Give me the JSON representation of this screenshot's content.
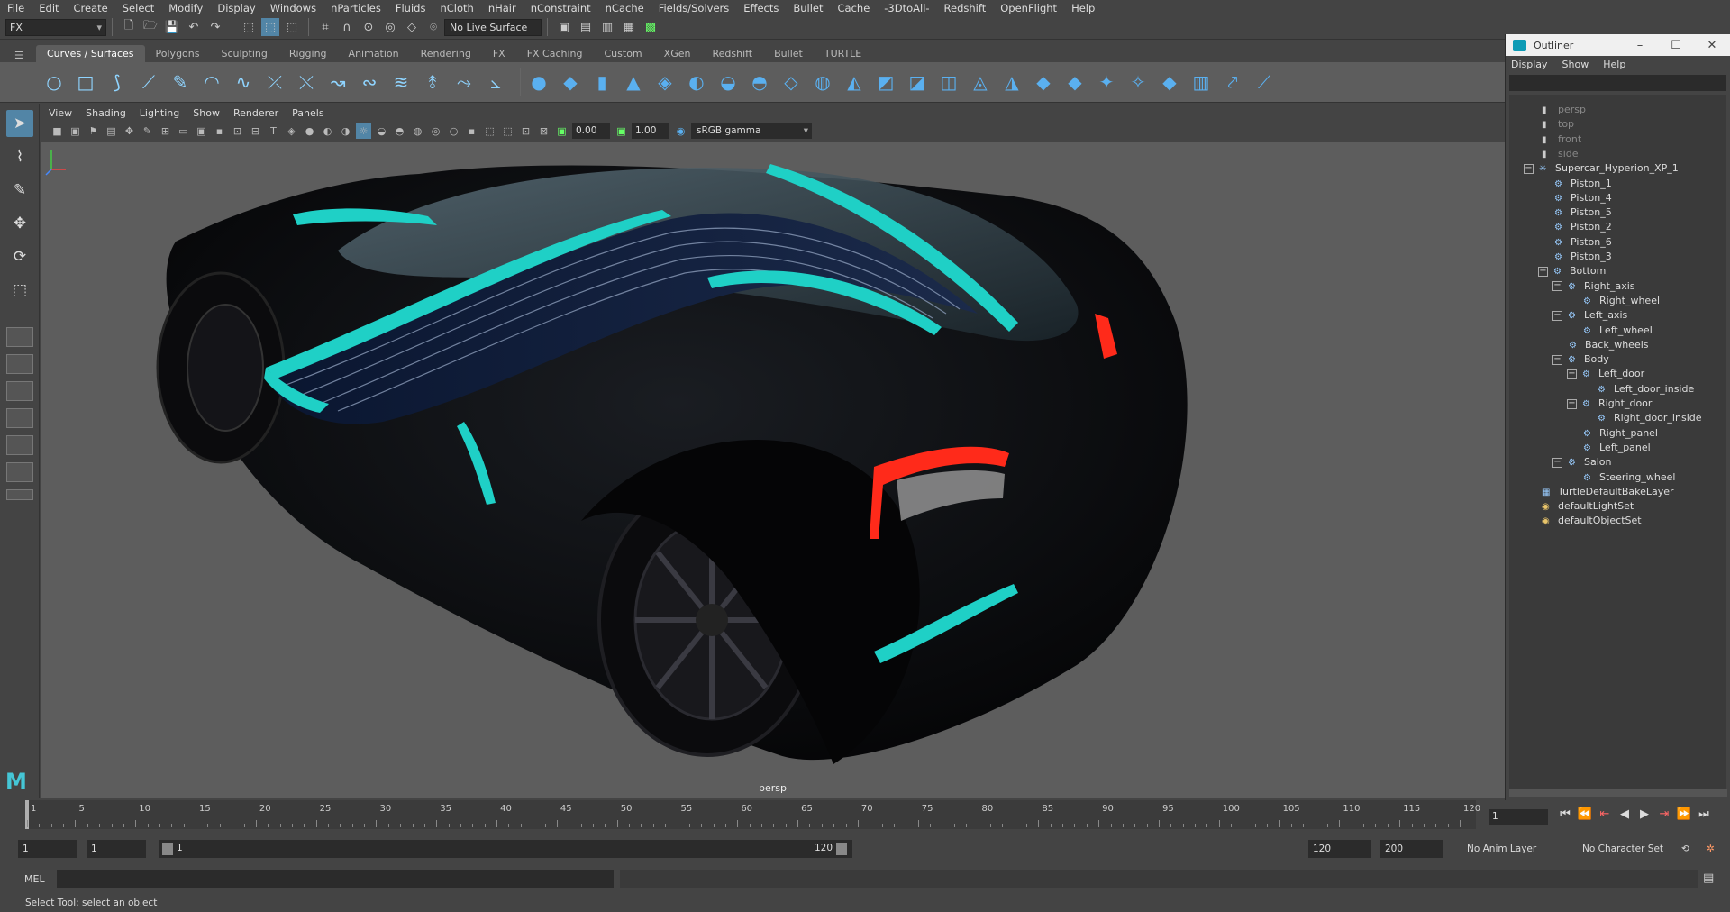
{
  "menubar": [
    "File",
    "Edit",
    "Create",
    "Select",
    "Modify",
    "Display",
    "Windows",
    "nParticles",
    "Fluids",
    "nCloth",
    "nHair",
    "nConstraint",
    "nCache",
    "Fields/Solvers",
    "Effects",
    "Bullet",
    "Cache",
    "-3DtoAll-",
    "Redshift",
    "OpenFlight",
    "Help"
  ],
  "statusline": {
    "mode": "FX",
    "live_surface": "No Live Surface"
  },
  "shelf": {
    "tabs": [
      "Curves / Surfaces",
      "Polygons",
      "Sculpting",
      "Rigging",
      "Animation",
      "Rendering",
      "FX",
      "FX Caching",
      "Custom",
      "XGen",
      "Redshift",
      "Bullet",
      "TURTLE"
    ],
    "active_tab": "Curves / Surfaces"
  },
  "panel": {
    "menu": [
      "View",
      "Shading",
      "Lighting",
      "Show",
      "Renderer",
      "Panels"
    ],
    "exposure": "0.00",
    "gamma": "1.00",
    "color_space": "sRGB gamma",
    "camera_label": "persp"
  },
  "outliner": {
    "title": "Outliner",
    "menu": [
      "Display",
      "Show",
      "Help"
    ],
    "items": [
      {
        "label": "persp",
        "depth": 0,
        "icon": "camera-icon",
        "dim": true
      },
      {
        "label": "top",
        "depth": 0,
        "icon": "camera-icon",
        "dim": true
      },
      {
        "label": "front",
        "depth": 0,
        "icon": "camera-icon",
        "dim": true
      },
      {
        "label": "side",
        "depth": 0,
        "icon": "camera-icon",
        "dim": true
      },
      {
        "label": "Supercar_Hyperion_XP_1",
        "depth": 0,
        "icon": "joint-icon",
        "expander": true
      },
      {
        "label": "Piston_1",
        "depth": 1,
        "icon": "transform-icon"
      },
      {
        "label": "Piston_4",
        "depth": 1,
        "icon": "transform-icon"
      },
      {
        "label": "Piston_5",
        "depth": 1,
        "icon": "transform-icon"
      },
      {
        "label": "Piston_2",
        "depth": 1,
        "icon": "transform-icon"
      },
      {
        "label": "Piston_6",
        "depth": 1,
        "icon": "transform-icon"
      },
      {
        "label": "Piston_3",
        "depth": 1,
        "icon": "transform-icon"
      },
      {
        "label": "Bottom",
        "depth": 1,
        "icon": "transform-icon",
        "expander": true
      },
      {
        "label": "Right_axis",
        "depth": 2,
        "icon": "transform-icon",
        "expander": true
      },
      {
        "label": "Right_wheel",
        "depth": 3,
        "icon": "transform-icon"
      },
      {
        "label": "Left_axis",
        "depth": 2,
        "icon": "transform-icon",
        "expander": true
      },
      {
        "label": "Left_wheel",
        "depth": 3,
        "icon": "transform-icon"
      },
      {
        "label": "Back_wheels",
        "depth": 2,
        "icon": "transform-icon"
      },
      {
        "label": "Body",
        "depth": 2,
        "icon": "transform-icon",
        "expander": true
      },
      {
        "label": "Left_door",
        "depth": 3,
        "icon": "transform-icon",
        "expander": true
      },
      {
        "label": "Left_door_inside",
        "depth": 4,
        "icon": "transform-icon"
      },
      {
        "label": "Right_door",
        "depth": 3,
        "icon": "transform-icon",
        "expander": true
      },
      {
        "label": "Right_door_inside",
        "depth": 4,
        "icon": "transform-icon"
      },
      {
        "label": "Right_panel",
        "depth": 3,
        "icon": "transform-icon"
      },
      {
        "label": "Left_panel",
        "depth": 3,
        "icon": "transform-icon"
      },
      {
        "label": "Salon",
        "depth": 2,
        "icon": "transform-icon",
        "expander": true
      },
      {
        "label": "Steering_wheel",
        "depth": 3,
        "icon": "transform-icon"
      },
      {
        "label": "TurtleDefaultBakeLayer",
        "depth": 0,
        "icon": "layer-icon"
      },
      {
        "label": "defaultLightSet",
        "depth": 0,
        "icon": "set-icon"
      },
      {
        "label": "defaultObjectSet",
        "depth": 0,
        "icon": "set-icon"
      }
    ]
  },
  "timeline": {
    "ticks": [
      "1",
      "5",
      "10",
      "15",
      "20",
      "25",
      "30",
      "35",
      "40",
      "45",
      "50",
      "55",
      "60",
      "65",
      "70",
      "75",
      "80",
      "85",
      "90",
      "95",
      "100",
      "105",
      "110",
      "115",
      "120"
    ],
    "current_frame": "1",
    "range_start": "1",
    "playback_start": "1",
    "range_slider_start": "1",
    "range_slider_end": "120",
    "playback_end": "120",
    "range_end": "200",
    "anim_layer": "No Anim Layer",
    "character_set": "No Character Set"
  },
  "cmdline": {
    "label": "MEL"
  },
  "helpline": "Select Tool: select an object",
  "colors": {
    "accent_teal": "#1fd0c6",
    "viewport_bg": "#5d5d5d",
    "tail_red": "#ff2a1a"
  }
}
